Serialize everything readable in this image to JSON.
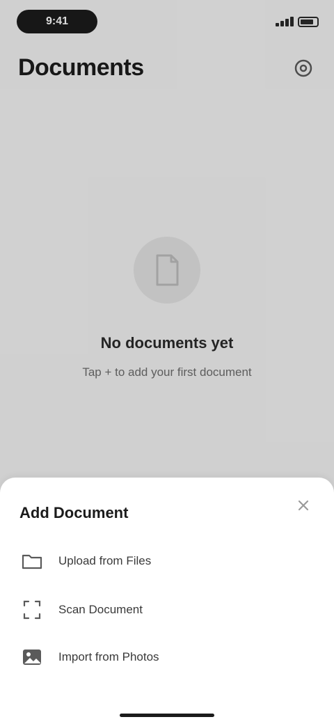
{
  "status_bar": {
    "time": "9:41",
    "battery_icon": "battery-icon",
    "signal_icon": "signal-icon"
  },
  "header": {
    "title": "Documents",
    "settings_icon": "settings-icon"
  },
  "empty_state": {
    "icon": "document-icon",
    "title": "No documents yet",
    "subtitle": "Tap + to add your first document"
  },
  "sheet": {
    "title": "Add Document",
    "close_icon": "close-icon",
    "options": [
      {
        "label": "Upload from Files",
        "icon": "folder-icon"
      },
      {
        "label": "Scan Document",
        "icon": "scan-icon"
      },
      {
        "label": "Import from Photos",
        "icon": "image-icon"
      }
    ]
  },
  "colors": {
    "background": "#f3f3f3",
    "sheet": "#ffffff",
    "text_primary": "#1b1b1b",
    "text_secondary": "#6d6d6d"
  }
}
